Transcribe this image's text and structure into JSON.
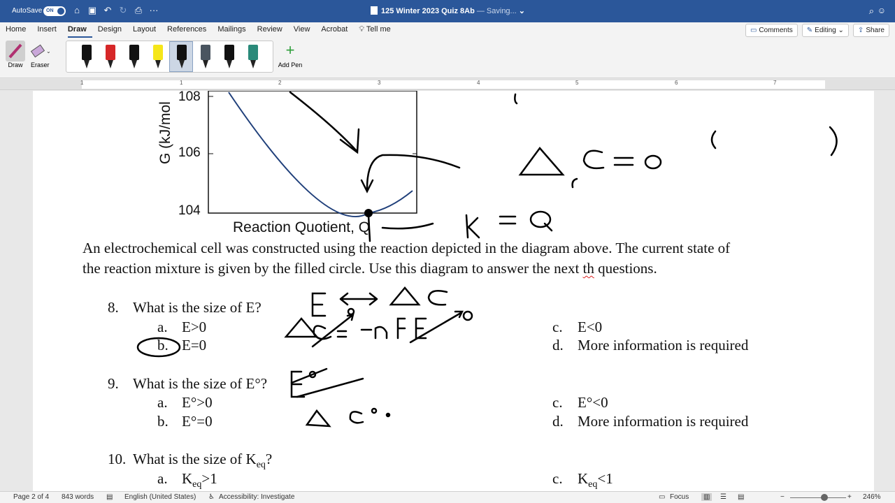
{
  "titlebar": {
    "autosave_label": "AutoSave",
    "autosave_state": "ON",
    "doc_title": "125 Winter 2023 Quiz 8Ab",
    "saving_status": "— Saving...",
    "search_icon": "search-icon",
    "chevron_icon": "chevron-down-icon"
  },
  "ribbon": {
    "tabs": [
      "Home",
      "Insert",
      "Draw",
      "Design",
      "Layout",
      "References",
      "Mailings",
      "Review",
      "View",
      "Acrobat",
      "Tell me"
    ],
    "active_tab": "Draw",
    "comments_label": "Comments",
    "editing_label": "Editing",
    "share_label": "Share",
    "draw_label": "Draw",
    "eraser_label": "Eraser",
    "add_pen_label": "Add Pen",
    "pens": [
      {
        "color": "#111111"
      },
      {
        "color": "#d62728"
      },
      {
        "color": "#111111"
      },
      {
        "color": "#f5e61a"
      },
      {
        "color": "#111111"
      },
      {
        "color": "#4a5560"
      },
      {
        "color": "#111111"
      },
      {
        "color": "#2a8a7a"
      }
    ]
  },
  "ruler": {
    "numbers": [
      "1",
      "1",
      "2",
      "3",
      "4",
      "5",
      "6",
      "7"
    ]
  },
  "plot": {
    "ylabel": "G (kJ/mol",
    "ticks": [
      "108",
      "106",
      "104"
    ],
    "xlabel": "Reaction Quotient, Q"
  },
  "document": {
    "intro_line1": "An electrochemical cell was constructed using the reaction depicted in the diagram above. The current state of",
    "intro_line2_a": "the reaction mixture is given by the filled circle.  Use this diagram to answer the next ",
    "intro_line2_b": "th",
    "intro_line2_c": " questions.",
    "q8": {
      "number": "8.",
      "text": "What is the size of E?",
      "a_letter": "a.",
      "a": "E>0",
      "b_letter": "b.",
      "b": "E=0",
      "c_letter": "c.",
      "c": "E<0",
      "d_letter": "d.",
      "d": "More information is required"
    },
    "q9": {
      "number": "9.",
      "text": "What is the size of E°?",
      "a_letter": "a.",
      "a": "E°>0",
      "b_letter": "b.",
      "b": "E°=0",
      "c_letter": "c.",
      "c": "E°<0",
      "d_letter": "d.",
      "d": "More information is required"
    },
    "q10": {
      "number": "10.",
      "text_a": "What is the size of K",
      "text_sub": "eq",
      "text_b": "?",
      "a_letter": "a.",
      "a_main": "K",
      "a_sub": "eq",
      "a_rest": ">1",
      "c_letter": "c.",
      "c_main": "K",
      "c_sub": "eq",
      "c_rest": "<1"
    }
  },
  "statusbar": {
    "page": "Page 2 of 4",
    "words": "843 words",
    "language": "English (United States)",
    "accessibility": "Accessibility: Investigate",
    "focus": "Focus",
    "zoom": "246%"
  },
  "colors": {
    "titlebar": "#2b579a",
    "curve": "#1f3f7a",
    "ink": "#000000"
  }
}
